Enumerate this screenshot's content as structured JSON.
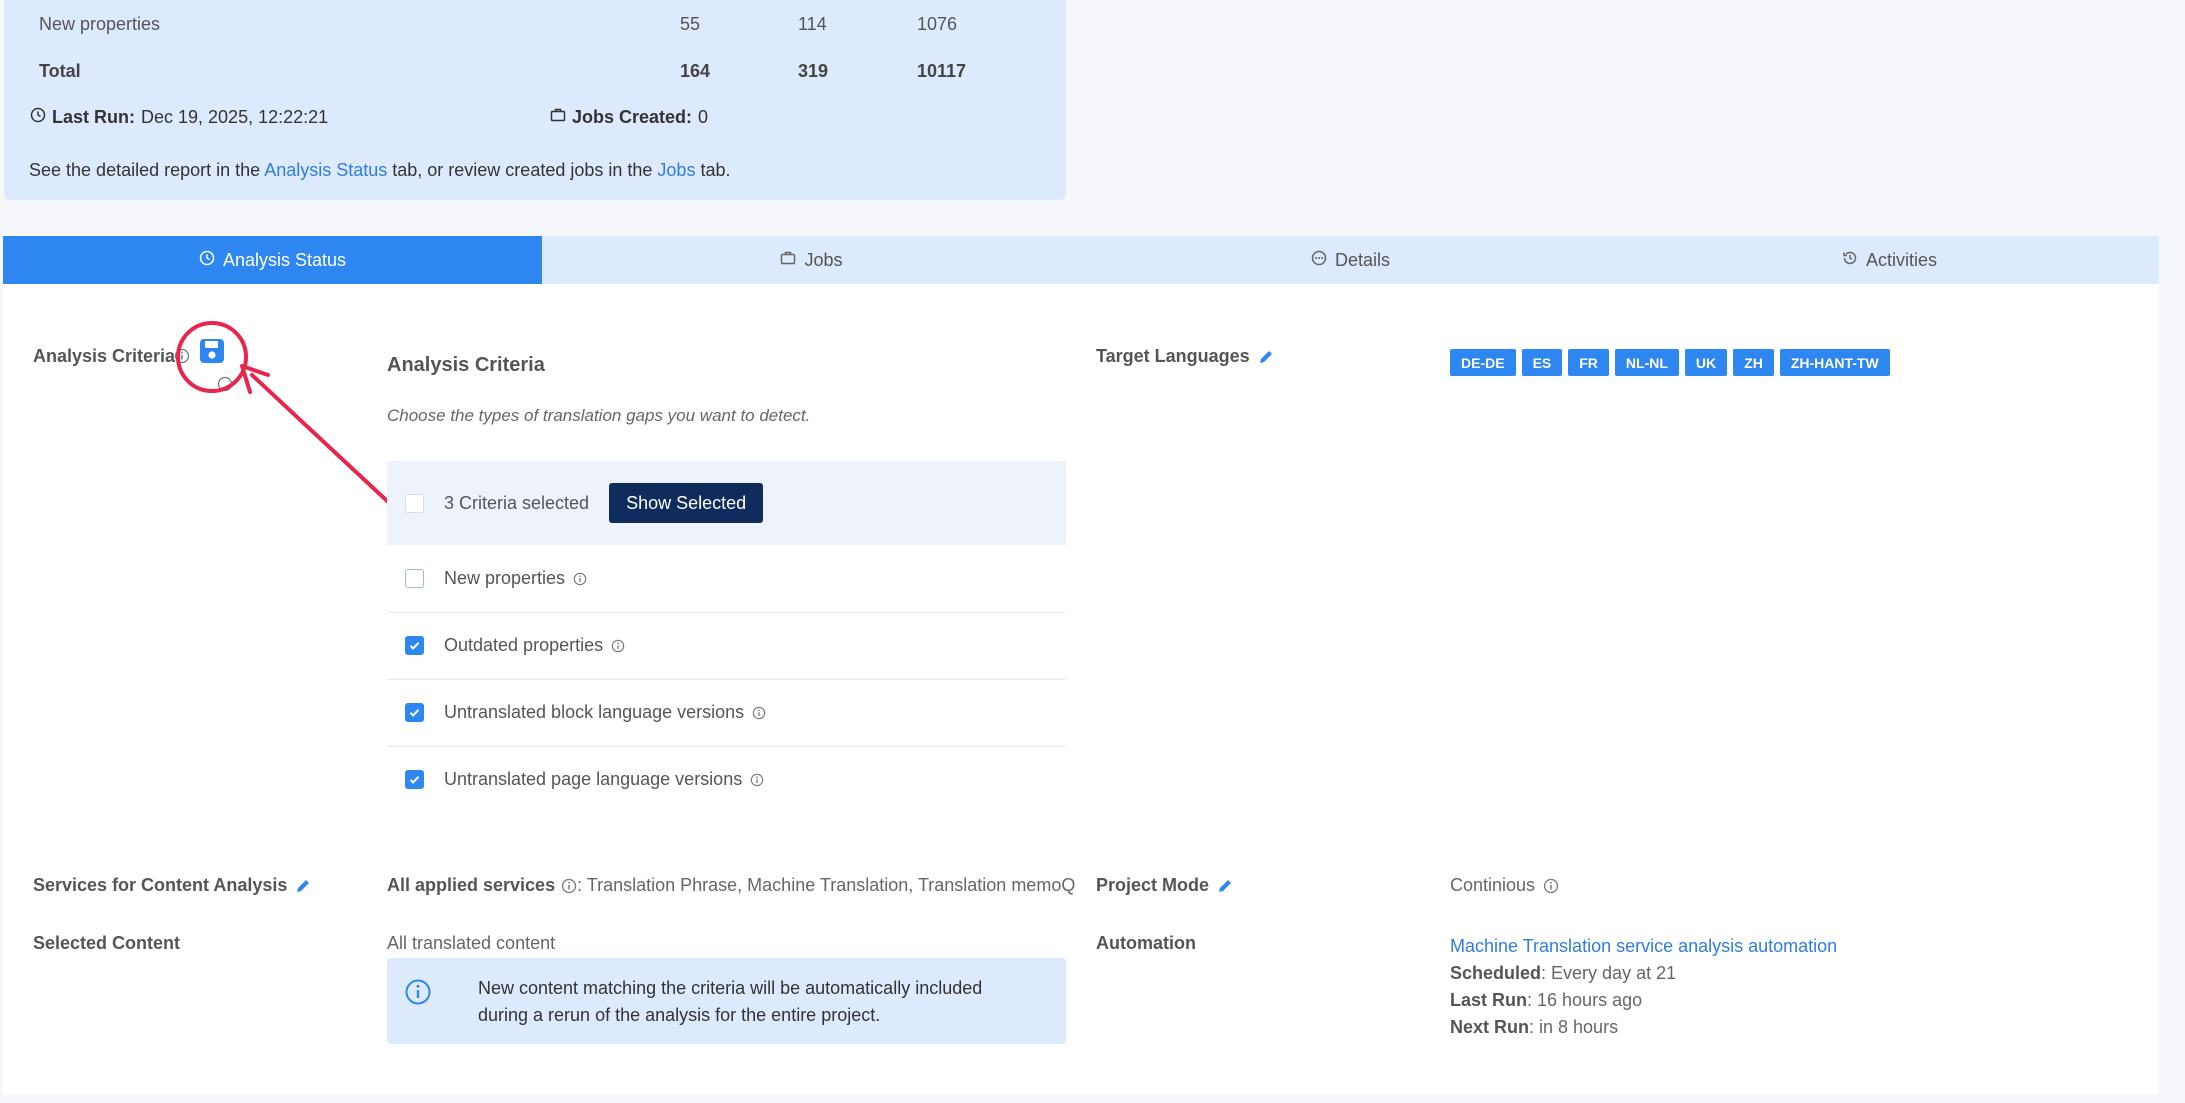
{
  "summary": {
    "rows": [
      {
        "label": "New properties",
        "c1": "55",
        "c2": "114",
        "c3": "1076"
      },
      {
        "label": "Total",
        "c1": "164",
        "c2": "319",
        "c3": "10117"
      }
    ],
    "last_run_label": "Last Run:",
    "last_run_value": "Dec 19, 2025, 12:22:21",
    "jobs_created_label": "Jobs Created:",
    "jobs_created_value": "0",
    "note_pre": "See the detailed report in the",
    "note_link1": "Analysis Status",
    "note_mid": "tab, or review created jobs in the",
    "note_link2": "Jobs",
    "note_post": "tab."
  },
  "tabs": [
    {
      "label": "Analysis Status",
      "icon": "clock-icon",
      "active": true
    },
    {
      "label": "Jobs",
      "icon": "briefcase-icon"
    },
    {
      "label": "Details",
      "icon": "dots-circle-icon"
    },
    {
      "label": "Activities",
      "icon": "history-icon"
    }
  ],
  "analysis": {
    "left_label": "Analysis Criteria",
    "title": "Analysis Criteria",
    "description": "Choose the types of translation gaps you want to detect.",
    "selected_count_text": "3 Criteria selected",
    "show_selected_label": "Show Selected",
    "criteria": [
      {
        "label": "New properties",
        "checked": false
      },
      {
        "label": "Outdated properties",
        "checked": true
      },
      {
        "label": "Untranslated block language versions",
        "checked": true
      },
      {
        "label": "Untranslated page language versions",
        "checked": true
      }
    ]
  },
  "target_languages": {
    "label": "Target Languages",
    "codes": [
      "DE-DE",
      "ES",
      "FR",
      "NL-NL",
      "UK",
      "ZH",
      "ZH-HANT-TW"
    ]
  },
  "services": {
    "label": "Services for Content Analysis",
    "applied_label": "All applied services",
    "applied_value": ": Translation Phrase, Machine Translation, Translation memoQ"
  },
  "project_mode": {
    "label": "Project Mode",
    "value": "Continious"
  },
  "selected_content": {
    "label": "Selected Content",
    "value": "All translated content",
    "notice_line1": "New content matching the criteria will be automatically included",
    "notice_line2": "during a rerun of the analysis for the entire project."
  },
  "automation": {
    "label": "Automation",
    "link": "Machine Translation service analysis automation",
    "scheduled_label": "Scheduled",
    "scheduled_value": ": Every day at 21",
    "last_run_label": "Last Run",
    "last_run_value": ": 16 hours ago",
    "next_run_label": "Next Run",
    "next_run_value": ": in 8 hours"
  },
  "colors": {
    "accent": "#2e86f0",
    "annotation": "#e8264d",
    "dark_button": "#0f2c5c",
    "light_panel": "#dde9fc"
  }
}
